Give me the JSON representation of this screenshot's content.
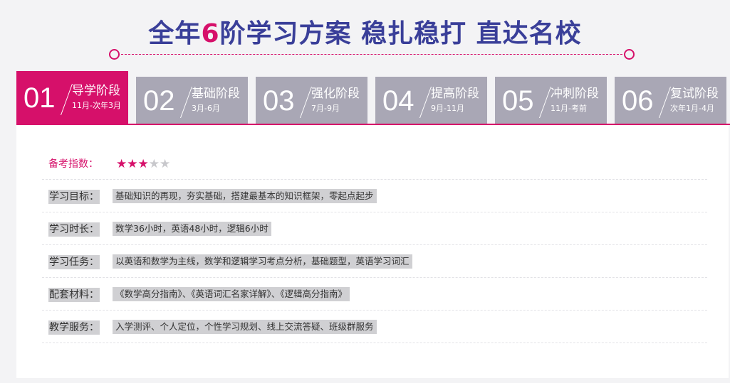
{
  "header": {
    "title_pre": "全年",
    "title_highlight": "6",
    "title_post": "阶学习方案 稳扎稳打 直达名校"
  },
  "colors": {
    "accent": "#d6106a",
    "title": "#3a3f99",
    "tab_inactive": "#a9a7b5"
  },
  "tabs": [
    {
      "num": "01",
      "name": "导学阶段",
      "range": "11月-次年3月",
      "active": true
    },
    {
      "num": "02",
      "name": "基础阶段",
      "range": "3月-6月",
      "active": false
    },
    {
      "num": "03",
      "name": "强化阶段",
      "range": "7月-9月",
      "active": false
    },
    {
      "num": "04",
      "name": "提高阶段",
      "range": "9月-11月",
      "active": false
    },
    {
      "num": "05",
      "name": "冲刺阶段",
      "range": "11月-考前",
      "active": false
    },
    {
      "num": "06",
      "name": "复试阶段",
      "range": "次年1月-4月",
      "active": false
    }
  ],
  "panel": {
    "index_label": "备考指数：",
    "rating": 3,
    "rating_max": 5,
    "rows": [
      {
        "label": "学习目标：",
        "value": "基础知识的再现，夯实基础，搭建最基本的知识框架，零起点起步"
      },
      {
        "label": "学习时长：",
        "value": "数学36小时，英语48小时，逻辑6小时"
      },
      {
        "label": "学习任务：",
        "value": "以英语和数学为主线，数学和逻辑学习考点分析，基础题型，英语学习词汇"
      },
      {
        "label": "配套材料：",
        "value": "《数学高分指南》、《英语词汇名家详解》、《逻辑高分指南》"
      },
      {
        "label": "教学服务：",
        "value": "入学测评、个人定位，个性学习规划、线上交流答疑、班级群服务"
      }
    ]
  }
}
